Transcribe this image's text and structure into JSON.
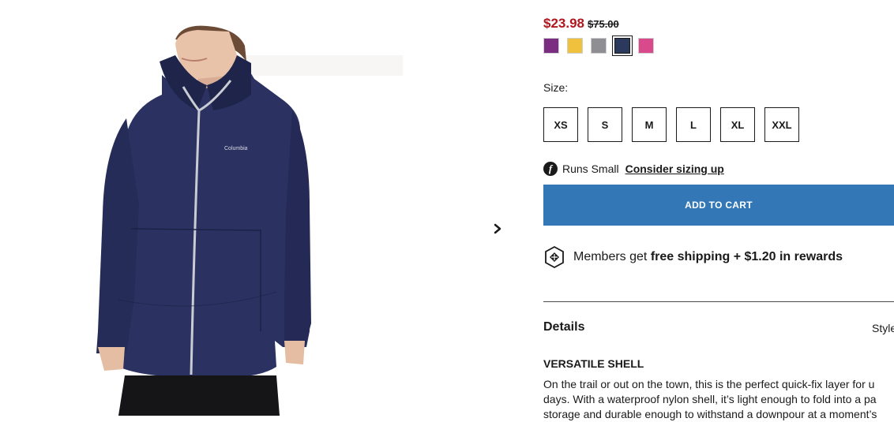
{
  "product": {
    "image_alt": "Woman wearing navy rain jacket",
    "jacket_logo": "Columbia"
  },
  "price": {
    "sale": "$23.98",
    "original": "$75.00"
  },
  "colors": {
    "swatches": [
      "#7b2d82",
      "#f0c13d",
      "#8f8f93",
      "#2b3a5c",
      "#d94a8c"
    ],
    "selected": "#2b3a5c"
  },
  "size": {
    "label": "Size:",
    "options": [
      "XS",
      "S",
      "M",
      "L",
      "XL",
      "XXL"
    ]
  },
  "fit": {
    "icon": "fit-predictor-icon",
    "text": "Runs Small",
    "link": "Consider sizing up"
  },
  "cart": {
    "button_label": "ADD TO CART",
    "color": "#3377b7"
  },
  "members": {
    "icon": "columbia-rewards-icon",
    "prefix": "Members get ",
    "highlight": "free shipping + $1.20 in rewards"
  },
  "details": {
    "heading": "Details",
    "style_label": "Style",
    "feature_title": "VERSATILE SHELL",
    "feature_lines": [
      "On the trail or out on the town, this is the perfect quick-fix layer for u",
      "days. With a waterproof nylon shell, it’s light enough to fold into a pa",
      "storage and durable enough to withstand a downpour at a moment’s"
    ]
  },
  "gallery": {
    "next_icon": "chevron-right-icon"
  }
}
